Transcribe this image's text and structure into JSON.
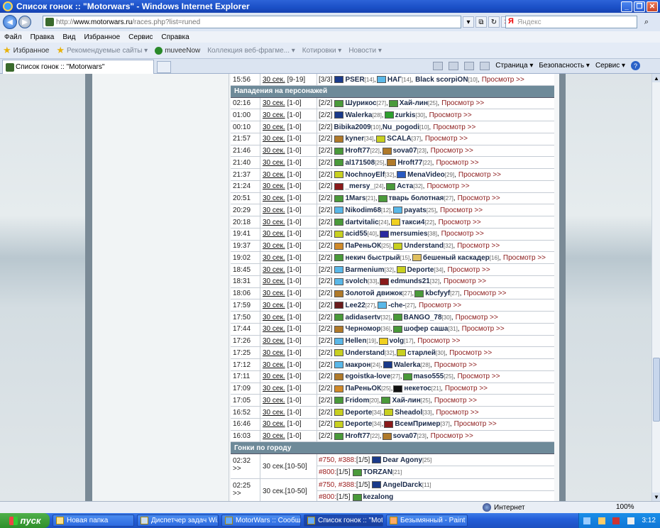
{
  "window": {
    "title": "Список гонок :: \"Motorwars\" - Windows Internet Explorer"
  },
  "address": {
    "prefix": "http://",
    "host": "www.motorwars.ru",
    "path": "/races.php?list=runed",
    "search_placeholder": "Яндекс"
  },
  "menu": [
    "Файл",
    "Правка",
    "Вид",
    "Избранное",
    "Сервис",
    "Справка"
  ],
  "favorites": {
    "label": "Избранное",
    "items": [
      "Рекомендуемые сайты ▾",
      "muveeNow",
      "Коллекция веб-фрагме... ▾",
      "Котировки ▾",
      "Новости ▾"
    ]
  },
  "tab": {
    "title": "Список гонок :: \"Motorwars\""
  },
  "commands": {
    "page": "Страница ▾",
    "security": "Безопасность ▾",
    "service": "Сервис ▾"
  },
  "races": {
    "top_row": {
      "time": "15:56",
      "dur": "30 сек.",
      "range": "[9-19]",
      "count": "[3/3]",
      "p1": "PSER",
      "l1": "[14]",
      "p2": "НАГ",
      "l2": "[14]",
      "p3": "Black scorpiON",
      "l3": "[10]",
      "view": "Просмотр >>"
    },
    "section_attacks": "Нападения на персонажей",
    "attacks": [
      {
        "time": "02:16",
        "count": "[2/2]",
        "p1": "Шурикос",
        "l1": "[27]",
        "p2": "Хай-лин",
        "l2": "[25]",
        "c1": "#4a9a3a",
        "c2": "#4a9a3a"
      },
      {
        "time": "01:00",
        "count": "[2/2]",
        "p1": "Walerka",
        "l1": "[28]",
        "p2": "zurkis",
        "l2": "[30]",
        "c1": "#1a3a8a",
        "c2": "#2fa02f"
      },
      {
        "time": "00:10",
        "count": "[2/2]",
        "p1": "Bibika2009",
        "l1": "[10]",
        "p2": "Nu_pogodi",
        "l2": "[10]",
        "c1": "",
        "c2": ""
      },
      {
        "time": "21:57",
        "count": "[2/2]",
        "p1": "kyner",
        "l1": "[34]",
        "p2": "SCALA",
        "l2": "[37]",
        "c1": "#b07a2a",
        "c2": "#c8d020"
      },
      {
        "time": "21:46",
        "count": "[2/2]",
        "p1": "Hroft77",
        "l1": "[22]",
        "p2": "sova07",
        "l2": "[23]",
        "c1": "#4a9a3a",
        "c2": "#b07a2a"
      },
      {
        "time": "21:40",
        "count": "[2/2]",
        "p1": "al171508",
        "l1": "[25]",
        "p2": "Hroft77",
        "l2": "[22]",
        "c1": "#4a9a3a",
        "c2": "#b07a2a"
      },
      {
        "time": "21:37",
        "count": "[2/2]",
        "p1": "NochnoyElf",
        "l1": "[32]",
        "p2": "MenaVideo",
        "l2": "[29]",
        "c1": "#c8d020",
        "c2": "#2a5ac0"
      },
      {
        "time": "21:24",
        "count": "[2/2]",
        "p1": "_mersy_",
        "l1": "[24]",
        "p2": "Аста",
        "l2": "[32]",
        "c1": "#8a1a1a",
        "c2": "#4a9a3a"
      },
      {
        "time": "20:51",
        "count": "[2/2]",
        "p1": "1Mars",
        "l1": "[21]",
        "p2": "тварь болотная",
        "l2": "[27]",
        "c1": "#4a9a3a",
        "c2": "#4a9a3a"
      },
      {
        "time": "20:29",
        "count": "[2/2]",
        "p1": "Nikodim68",
        "l1": "[12]",
        "p2": "payats",
        "l2": "[25]",
        "c1": "#5ab8e8",
        "c2": "#5ab8e8"
      },
      {
        "time": "20:18",
        "count": "[2/2]",
        "p1": "dartvitalic",
        "l1": "[24]",
        "p2": "такси4",
        "l2": "[22]",
        "c1": "#4a9a3a",
        "c2": "#f0d020"
      },
      {
        "time": "19:41",
        "count": "[2/2]",
        "p1": "acid55",
        "l1": "[40]",
        "p2": "mersumies",
        "l2": "[38]",
        "c1": "#c8d020",
        "c2": "#2a2aa0"
      },
      {
        "time": "19:37",
        "count": "[2/2]",
        "p1": "ПаРеньОК",
        "l1": "[25]",
        "p2": "Understand",
        "l2": "[32]",
        "c1": "#d08a2a",
        "c2": "#c8d020"
      },
      {
        "time": "19:02",
        "count": "[2/2]",
        "p1": "некич быстрый",
        "l1": "[15]",
        "p2": "бешеный каскадер",
        "l2": "[16]",
        "c1": "#4a9a3a",
        "c2": "#e0c060"
      },
      {
        "time": "18:45",
        "count": "[2/2]",
        "p1": "Barmenium",
        "l1": "[32]",
        "p2": "Deporte",
        "l2": "[34]",
        "c1": "#5ab8e8",
        "c2": "#c8d020"
      },
      {
        "time": "18:31",
        "count": "[2/2]",
        "p1": "svolch",
        "l1": "[33]",
        "p2": "edmunds21",
        "l2": "[32]",
        "c1": "#5ab8e8",
        "c2": "#8a1a1a"
      },
      {
        "time": "18:06",
        "count": "[2/2]",
        "p1": "Золотой движок",
        "l1": "[27]",
        "p2": "kbcfyyf",
        "l2": "[27]",
        "c1": "#b07a2a",
        "c2": "#4a9a3a"
      },
      {
        "time": "17:59",
        "count": "[2/2]",
        "p1": "Lee22",
        "l1": "[27]",
        "p2": "-che-",
        "l2": "[27]",
        "c1": "#6a1a1a",
        "c2": "#5ab8e8"
      },
      {
        "time": "17:50",
        "count": "[2/2]",
        "p1": "adidasertv",
        "l1": "[32]",
        "p2": "BANGO_78",
        "l2": "[30]",
        "c1": "#4a9a3a",
        "c2": "#4a9a3a"
      },
      {
        "time": "17:44",
        "count": "[2/2]",
        "p1": "Черномор",
        "l1": "[36]",
        "p2": "шофер саша",
        "l2": "[31]",
        "c1": "#b07a2a",
        "c2": "#4a9a3a"
      },
      {
        "time": "17:26",
        "count": "[2/2]",
        "p1": "Hellen",
        "l1": "[19]",
        "p2": "volg",
        "l2": "[17]",
        "c1": "#5ab8e8",
        "c2": "#f0d020"
      },
      {
        "time": "17:25",
        "count": "[2/2]",
        "p1": "Understand",
        "l1": "[32]",
        "p2": "старлей",
        "l2": "[30]",
        "c1": "#c8d020",
        "c2": "#c8d020"
      },
      {
        "time": "17:12",
        "count": "[2/2]",
        "p1": "макрон",
        "l1": "[24]",
        "p2": "Walerka",
        "l2": "[28]",
        "c1": "#5ab8e8",
        "c2": "#1a3a8a"
      },
      {
        "time": "17:11",
        "count": "[2/2]",
        "p1": "egoistka-love",
        "l1": "[27]",
        "p2": "maso555",
        "l2": "[25]",
        "c1": "#b07a2a",
        "c2": "#4a9a3a"
      },
      {
        "time": "17:09",
        "count": "[2/2]",
        "p1": "ПаРеньОК",
        "l1": "[25]",
        "p2": "некетос",
        "l2": "[21]",
        "c1": "#d08a2a",
        "c2": "#111111"
      },
      {
        "time": "17:05",
        "count": "[2/2]",
        "p1": "Fridom",
        "l1": "[20]",
        "p2": "Хай-лин",
        "l2": "[25]",
        "c1": "#4a9a3a",
        "c2": "#4a9a3a"
      },
      {
        "time": "16:52",
        "count": "[2/2]",
        "p1": "Deporte",
        "l1": "[34]",
        "p2": "Sheadol",
        "l2": "[33]",
        "c1": "#c8d020",
        "c2": "#c8d020"
      },
      {
        "time": "16:46",
        "count": "[2/2]",
        "p1": "Deporte",
        "l1": "[34]",
        "p2": "ВсемПример",
        "l2": "[37]",
        "c1": "#c8d020",
        "c2": "#8a1a1a"
      },
      {
        "time": "16:03",
        "count": "[2/2]",
        "p1": "Hroft77",
        "l1": "[22]",
        "p2": "sova07",
        "l2": "[23]",
        "c1": "#4a9a3a",
        "c2": "#b07a2a"
      }
    ],
    "attack_dur": "30 сек.",
    "attack_range": "[1-0]",
    "view": "Просмотр >>",
    "section_city": "Гонки по городу",
    "city": [
      {
        "time": "02:32",
        "arrow": ">>",
        "dur": "30 сек.",
        "range": "[10-50]",
        "lines": [
          {
            "ids": "#750, #388:",
            "count": "[1/5]",
            "player": "Dear Agony",
            "lvl": "[25]",
            "color": "#1a3a8a"
          },
          {
            "ids": "#800:",
            "count": "[1/5]",
            "player": "TORZAN",
            "lvl": "[21]",
            "color": "#4a9a3a"
          }
        ]
      },
      {
        "time": "02:25",
        "arrow": ">>",
        "dur": "30 сек.",
        "range": "[10-50]",
        "lines": [
          {
            "ids": "#750, #388:",
            "count": "[1/5]",
            "player": "AngelDarck",
            "lvl": "[11]",
            "color": "#1a3a8a"
          },
          {
            "ids": "#800:",
            "count": "[1/5]",
            "player": "kezalong",
            "lvl": "",
            "color": "#4a9a3a"
          }
        ]
      }
    ]
  },
  "status": {
    "zone": "Интернет",
    "zoom": "100%"
  },
  "taskbar": {
    "start": "пуск",
    "items": [
      "Новая папка",
      "Диспетчер задач Wi...",
      "MotorWars :: Сообщ...",
      "Список гонок :: \"Mot...",
      "Безымянный - Paint"
    ],
    "lang": "RU",
    "clock": "3:12"
  }
}
